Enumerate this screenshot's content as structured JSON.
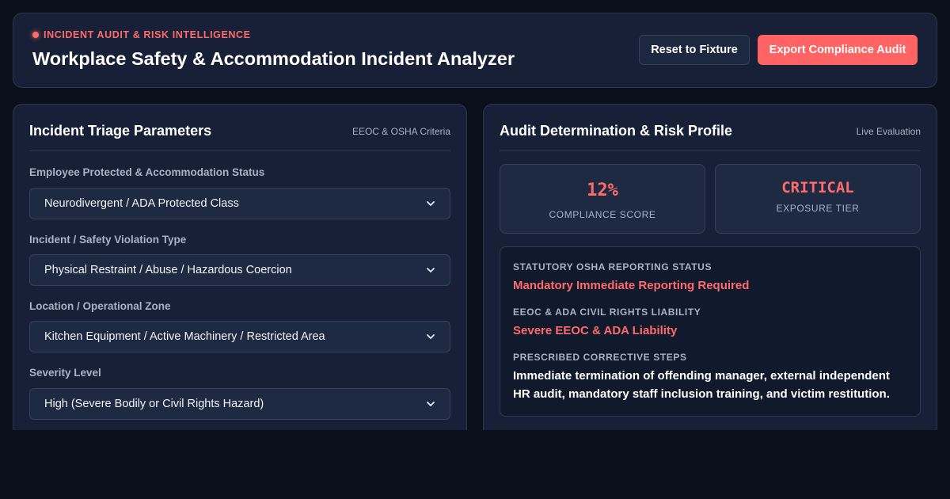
{
  "header": {
    "eyebrow": "INCIDENT AUDIT & RISK INTELLIGENCE",
    "title": "Workplace Safety & Accommodation Incident Analyzer",
    "reset_label": "Reset to Fixture",
    "export_label": "Export Compliance Audit"
  },
  "triage": {
    "title": "Incident Triage Parameters",
    "meta": "EEOC & OSHA Criteria",
    "fields": [
      {
        "label": "Employee Protected & Accommodation Status",
        "value": "Neurodivergent / ADA Protected Class"
      },
      {
        "label": "Incident / Safety Violation Type",
        "value": "Physical Restraint / Abuse / Hazardous Coercion"
      },
      {
        "label": "Location / Operational Zone",
        "value": "Kitchen Equipment / Active Machinery / Restricted Area"
      },
      {
        "label": "Severity Level",
        "value": "High (Severe Bodily or Civil Rights Hazard)"
      }
    ]
  },
  "audit": {
    "title": "Audit Determination & Risk Profile",
    "meta": "Live Evaluation",
    "compliance_score": "12%",
    "compliance_label": "COMPLIANCE SCORE",
    "exposure_tier": "CRITICAL",
    "exposure_label": "EXPOSURE TIER",
    "osha_label": "STATUTORY OSHA REPORTING STATUS",
    "osha_value": "Mandatory Immediate Reporting Required",
    "eeoc_label": "EEOC & ADA CIVIL RIGHTS LIABILITY",
    "eeoc_value": "Severe EEOC & ADA Liability",
    "steps_label": "PRESCRIBED CORRECTIVE STEPS",
    "steps_value": "Immediate termination of offending manager, external independent HR audit, mandatory staff inclusion training, and victim restitution."
  },
  "colors": {
    "accent": "#ff6b6b",
    "background": "#0a0f1c",
    "panel": "#172036"
  },
  "icons": {
    "status_dot": "red-dot-icon",
    "select_chevron": "chevron-down-icon"
  }
}
